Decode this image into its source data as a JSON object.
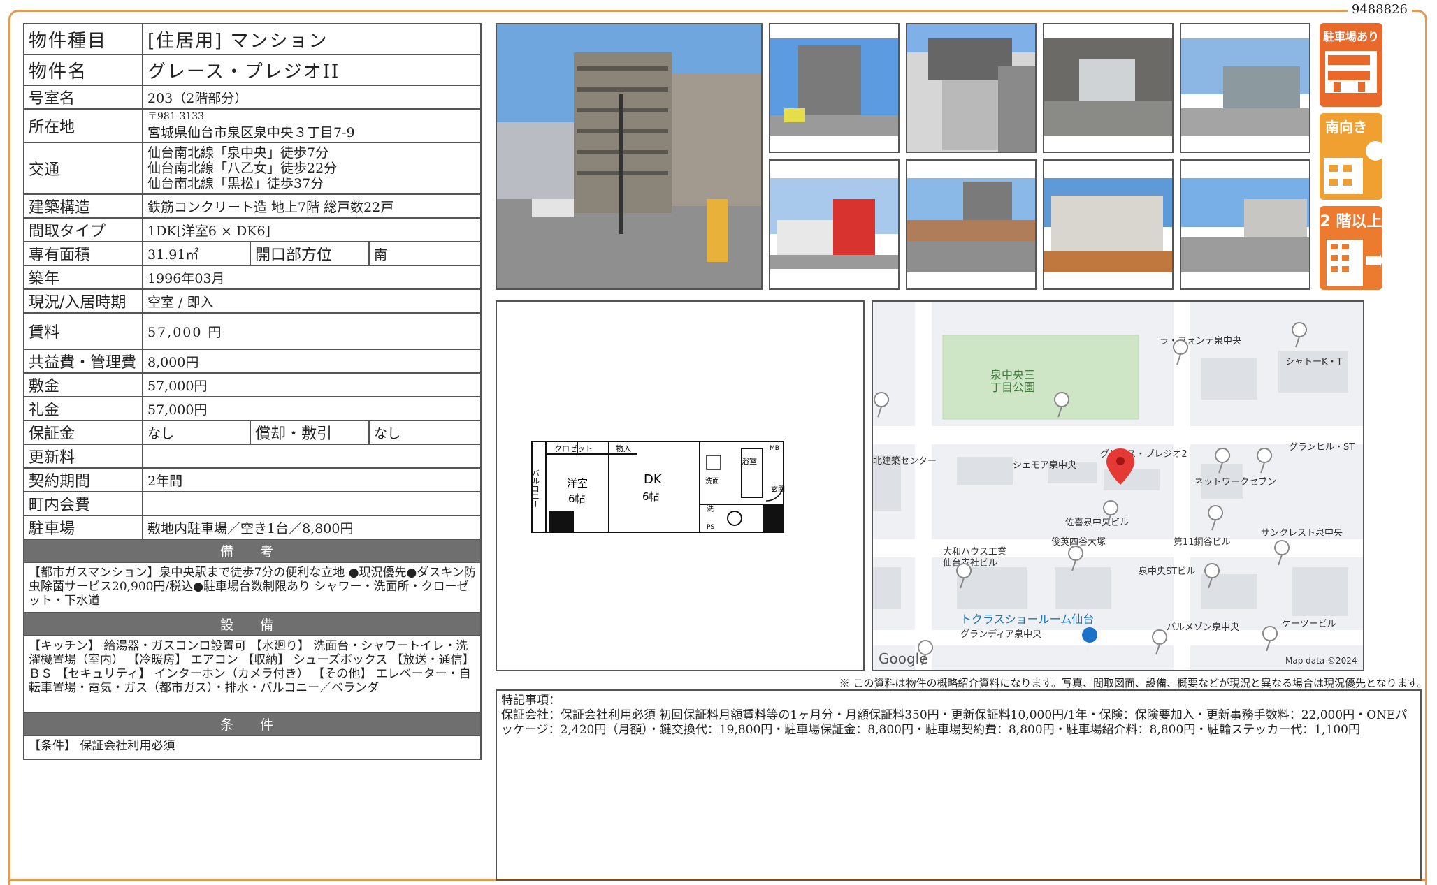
{
  "doc_id": "9488826",
  "rows": {
    "type": {
      "label": "物件種目",
      "value": "[住居用]  マンション"
    },
    "name": {
      "label": "物件名",
      "value": "グレース・プレジオII"
    },
    "room": {
      "label": "号室名",
      "value": "203（2階部分）"
    },
    "address": {
      "label": "所在地",
      "postal": "〒981-3133",
      "value": "宮城県仙台市泉区泉中央３丁目7-9"
    },
    "access": {
      "label": "交通",
      "lines": [
        "仙台南北線「泉中央」徒歩7分",
        "仙台南北線「八乙女」徒歩22分",
        "仙台南北線「黒松」徒歩37分"
      ]
    },
    "structure": {
      "label": "建築構造",
      "value": "鉄筋コンクリート造  地上7階  総戸数22戸"
    },
    "layout": {
      "label": "間取タイプ",
      "value": "1DK[洋室6 × DK6]"
    },
    "area": {
      "label": "専有面積",
      "value": "31.91㎡",
      "label2": "開口部方位",
      "value2": "南"
    },
    "built": {
      "label": "築年",
      "value": "1996年03月"
    },
    "status": {
      "label": "現況/入居時期",
      "value": "空室 / 即入"
    },
    "rent": {
      "label": "賃料",
      "value": "57,000 円"
    },
    "fee": {
      "label": "共益費・管理費",
      "value": "8,000円"
    },
    "deposit": {
      "label": "敷金",
      "value": "57,000円"
    },
    "key_money": {
      "label": "礼金",
      "value": "57,000円"
    },
    "guarantee": {
      "label": "保証金",
      "value": "なし",
      "label2": "償却・敷引",
      "value2": "なし"
    },
    "renewal": {
      "label": "更新料",
      "value": ""
    },
    "contract": {
      "label": "契約期間",
      "value": "2年間"
    },
    "town_fee": {
      "label": "町内会費",
      "value": ""
    },
    "parking": {
      "label": "駐車場",
      "value": "敷地内駐車場／空き1台／8,800円"
    }
  },
  "remarks": {
    "title": "備 考",
    "text": "【都市ガスマンション】泉中央駅まで徒歩7分の便利な立地 ●現況優先●ダスキン防虫除菌サービス20,900円/税込●駐車場台数制限あり シャワー・洗面所・クローゼット・下水道"
  },
  "equipment": {
    "title": "設 備",
    "text": "【キッチン】 給湯器・ガスコンロ設置可 【水廻り】 洗面台・シャワートイレ・洗濯機置場（室内） 【冷暖房】 エアコン 【収納】 シューズボックス 【放送・通信】 ＢＳ 【セキュリティ】 インターホン（カメラ付き） 【その他】 エレベーター・自転車置場・電気・ガス（都市ガス）・排水・バルコニー／ベランダ"
  },
  "conditions": {
    "title": "条 件",
    "text": "【条件】 保証会社利用必須"
  },
  "badges": {
    "parking": "駐車場あり",
    "south": "南向き",
    "floor": "2 階以上"
  },
  "floorplan": {
    "closet": "クロゼット",
    "storage": "物入",
    "balcony": "バルコニー",
    "western": "洋室",
    "western_size": "6帖",
    "dk": "DK",
    "dk_size": "6帖",
    "wash": "洗面",
    "bath": "浴室",
    "entrance": "玄関",
    "mb": "MB",
    "laundry": "洗",
    "ps": "PS"
  },
  "map": {
    "park": "泉中央三\n丁目公園",
    "labels": [
      "ラ・フォンテ泉中央",
      "シャトーK・T",
      "グランヒル・ST",
      "北建築センター",
      "シェモア泉中央",
      "グレース・プレジオ2",
      "ネットワークセブン",
      "佐喜泉中央ビル",
      "俊英四谷大塚",
      "第11銅谷ビル",
      "サンクレスト泉中央",
      "大和ハウス工業\n仙台支社ビル",
      "泉中央STビル",
      "トクラスショールーム仙台",
      "グランディア泉中央",
      "パルメゾン泉中央",
      "ケーツービル"
    ],
    "google": "Google",
    "credit": "Map data ©2024"
  },
  "note": "※ この資料は物件の概略紹介資料になります。写真、間取図面、設備、概要などが現況と異なる場合は現況優先となります。",
  "special": {
    "title": "特記事項：",
    "text": "保証会社：保証会社利用必須 初回保証料月額賃料等の1ヶ月分・月額保証料350円・更新保証料10,000円/1年・保険：保険要加入・更新事務手数料：22,000円・ONEパッケージ：2,420円（月額）・鍵交換代：19,800円・駐車場保証金：8,800円・駐車場契約費：8,800円・駐車場紹介料：8,800円・駐輪ステッカー代：1,100円"
  }
}
